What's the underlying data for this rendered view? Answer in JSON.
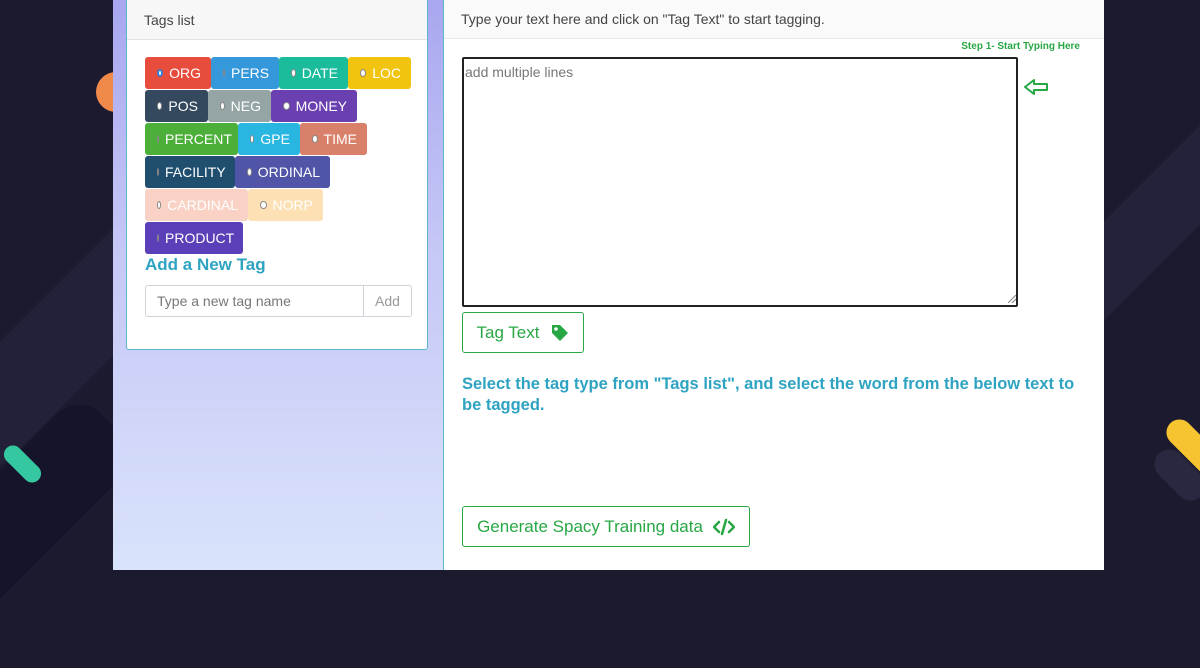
{
  "tags_card": {
    "header": "Tags list",
    "tags": [
      {
        "label": "ORG",
        "color": "#e84c3d",
        "text_color": "#ffffff",
        "selected": true
      },
      {
        "label": "PERS",
        "color": "#3498db",
        "text_color": "#ffffff",
        "selected": false
      },
      {
        "label": "DATE",
        "color": "#1abc9c",
        "text_color": "#ffffff",
        "selected": false
      },
      {
        "label": "LOC",
        "color": "#f1c40f",
        "text_color": "#ffffff",
        "selected": false
      },
      {
        "label": "POS",
        "color": "#34495e",
        "text_color": "#ffffff",
        "selected": false
      },
      {
        "label": "NEG",
        "color": "#95a5a6",
        "text_color": "#ffffff",
        "selected": false
      },
      {
        "label": "MONEY",
        "color": "#6a3fb0",
        "text_color": "#ffffff",
        "selected": false
      },
      {
        "label": "PERCENT",
        "color": "#4caf3a",
        "text_color": "#ffffff",
        "selected": false
      },
      {
        "label": "GPE",
        "color": "#29b6e0",
        "text_color": "#ffffff",
        "selected": false
      },
      {
        "label": "TIME",
        "color": "#d9806a",
        "text_color": "#ffffff",
        "selected": false
      },
      {
        "label": "FACILITY",
        "color": "#1f4e6e",
        "text_color": "#ffffff",
        "selected": false
      },
      {
        "label": "ORDINAL",
        "color": "#5055a8",
        "text_color": "#ffffff",
        "selected": false
      },
      {
        "label": "CARDINAL",
        "color": "#f9d2c5",
        "text_color": "#ffffff",
        "selected": false
      },
      {
        "label": "NORP",
        "color": "#fde0b3",
        "text_color": "#ffffff",
        "selected": false
      },
      {
        "label": "PRODUCT",
        "color": "#5a3fb8",
        "text_color": "#ffffff",
        "selected": false
      }
    ],
    "add_title": "Add a New Tag",
    "new_tag_placeholder": "Type a new tag name",
    "add_button": "Add"
  },
  "editor": {
    "header": "Type your text here and click on \"Tag Text\" to start tagging.",
    "step_hint": "Step 1- Start Typing Here",
    "textarea_placeholder": "add multiple lines",
    "arrow_icon": "arrow-left-icon",
    "tag_text_button": "Tag Text",
    "tag_icon": "tag-icon",
    "instructions": "Select the tag type from \"Tags list\", and select the word from the below text to be tagged.",
    "generate_button": "Generate Spacy Training data",
    "code_icon": "code-icon",
    "accent_green": "#28a745",
    "accent_blue": "#2ea3c2"
  }
}
